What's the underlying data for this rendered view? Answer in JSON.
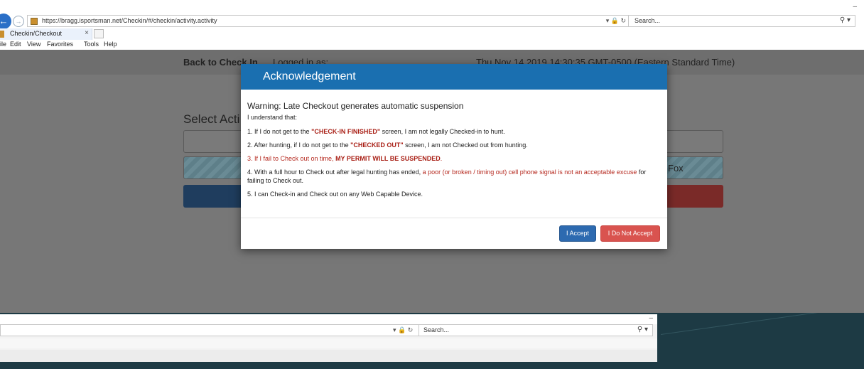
{
  "browser": {
    "url": "https://bragg.isportsman.net/Checkin/#/checkin/activity.activity",
    "search_placeholder": "Search...",
    "tab_label": "Checkin/Checkout",
    "menu": [
      "ile",
      "Edit",
      "View",
      "Favorites",
      "Tools",
      "Help"
    ]
  },
  "page": {
    "back_link": "Back to Check In",
    "logged_in": "Logged in as:",
    "datetime": "Thu Nov 14 2019 14:30:35 GMT-0500 (Eastern Standard Time)",
    "select_title": "Select Acti",
    "fox_text": "Fox"
  },
  "modal": {
    "title": "Acknowledgement",
    "warning": "Warning: Late Checkout generates automatic suspension",
    "intro": "I understand that:",
    "items": [
      {
        "pre": "1.  If I do not get to the ",
        "bold": "\"CHECK-IN FINISHED\"",
        "post": " screen, I am not legally Checked-in to hunt."
      },
      {
        "pre": "2.  After hunting, if I do not get to the ",
        "bold": "\"CHECKED OUT\"",
        "post": " screen, I am not Checked out from hunting."
      },
      {
        "pre": "3.  If I fail to Check out on time, ",
        "bold": "MY PERMIT WILL BE SUSPENDED",
        "post": "."
      },
      {
        "pre": "4.  With a full hour to Check out after legal hunting has ended, ",
        "red": "a poor (or broken / timing out) cell phone signal is not an acceptable excuse",
        "post": " for failing to Check out."
      },
      {
        "pre": "5.  I can Check-in and Check out on any Web Capable Device."
      }
    ],
    "accept_label": "I Accept",
    "decline_label": "I Do Not Accept"
  },
  "second_window": {
    "search_placeholder": "Search..."
  },
  "colors": {
    "modal_header": "#1a6fb0",
    "accept_button": "#2d6ab0",
    "decline_button": "#d9534f",
    "warning_red": "#b5281e"
  }
}
